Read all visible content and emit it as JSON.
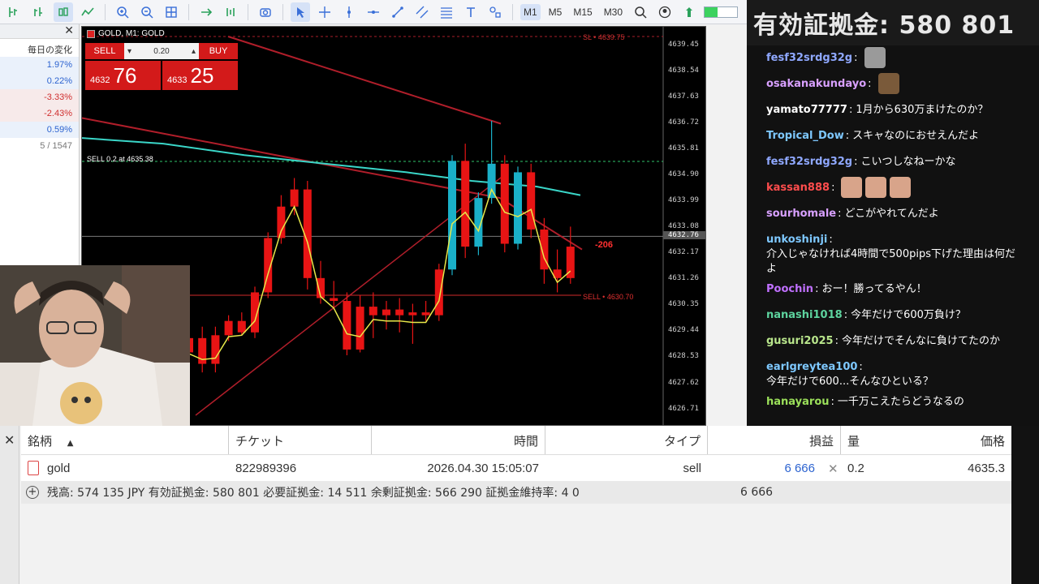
{
  "timeframes": [
    "M1",
    "M5",
    "M15",
    "M30"
  ],
  "market_watch": {
    "column": "毎日の変化",
    "rows": [
      {
        "value": "1.97%",
        "dir": "pos"
      },
      {
        "value": "0.22%",
        "dir": "pos"
      },
      {
        "value": "-3.33%",
        "dir": "neg"
      },
      {
        "value": "-2.43%",
        "dir": "neg"
      },
      {
        "value": "0.59%",
        "dir": "pos"
      }
    ],
    "footer": "5 / 1547"
  },
  "chart": {
    "title": "GOLD, M1:  GOLD",
    "trade_panel": {
      "sell": "SELL",
      "buy": "BUY",
      "lot": "0.20",
      "sell_prefix": "4632",
      "sell_big": "76",
      "buy_prefix": "4633",
      "buy_big": "25"
    },
    "annotations": {
      "order_line": "SELL 0.2 at 4635.38",
      "sl_line": "SL • 4639.75",
      "sell_line": "SELL • 4630.70",
      "profit": "-206",
      "current_price": "4632.76"
    },
    "price_labels": [
      "4639.45",
      "4638.54",
      "4637.63",
      "4636.72",
      "4635.81",
      "4634.90",
      "4633.99",
      "4633.08",
      "4632.17",
      "4631.26",
      "4630.35",
      "4629.44",
      "4628.53",
      "4627.62",
      "4626.71"
    ]
  },
  "chart_data": {
    "type": "candlestick",
    "title": "GOLD, M1:  GOLD",
    "ylim": [
      4626.5,
      4639.75
    ],
    "candles": [
      {
        "o": 4628.7,
        "h": 4629.3,
        "l": 4627.9,
        "c": 4629.2
      },
      {
        "o": 4629.2,
        "h": 4629.6,
        "l": 4628.0,
        "c": 4628.3
      },
      {
        "o": 4628.3,
        "h": 4629.6,
        "l": 4628.0,
        "c": 4629.3
      },
      {
        "o": 4629.3,
        "h": 4630.0,
        "l": 4629.1,
        "c": 4629.8
      },
      {
        "o": 4629.8,
        "h": 4630.1,
        "l": 4629.3,
        "c": 4629.4
      },
      {
        "o": 4629.4,
        "h": 4631.0,
        "l": 4629.2,
        "c": 4630.8
      },
      {
        "o": 4630.8,
        "h": 4632.9,
        "l": 4630.6,
        "c": 4632.7
      },
      {
        "o": 4632.7,
        "h": 4634.2,
        "l": 4632.5,
        "c": 4633.8
      },
      {
        "o": 4633.8,
        "h": 4634.8,
        "l": 4633.5,
        "c": 4634.4
      },
      {
        "o": 4634.4,
        "h": 4634.7,
        "l": 4630.9,
        "c": 4631.3
      },
      {
        "o": 4631.3,
        "h": 4631.9,
        "l": 4630.4,
        "c": 4630.6
      },
      {
        "o": 4630.6,
        "h": 4631.2,
        "l": 4630.2,
        "c": 4630.5
      },
      {
        "o": 4630.5,
        "h": 4630.8,
        "l": 4628.6,
        "c": 4628.8
      },
      {
        "o": 4628.8,
        "h": 4630.7,
        "l": 4628.7,
        "c": 4630.3
      },
      {
        "o": 4630.3,
        "h": 4630.8,
        "l": 4629.2,
        "c": 4630.0
      },
      {
        "o": 4630.0,
        "h": 4630.5,
        "l": 4629.5,
        "c": 4630.2
      },
      {
        "o": 4630.2,
        "h": 4630.6,
        "l": 4629.4,
        "c": 4630.0
      },
      {
        "o": 4630.0,
        "h": 4630.4,
        "l": 4629.0,
        "c": 4630.1
      },
      {
        "o": 4630.1,
        "h": 4630.5,
        "l": 4629.8,
        "c": 4630.0
      },
      {
        "o": 4630.0,
        "h": 4631.8,
        "l": 4629.8,
        "c": 4631.6
      },
      {
        "o": 4631.6,
        "h": 4635.6,
        "l": 4631.4,
        "c": 4635.4
      },
      {
        "o": 4635.4,
        "h": 4636.0,
        "l": 4632.0,
        "c": 4632.4
      },
      {
        "o": 4632.4,
        "h": 4634.3,
        "l": 4632.1,
        "c": 4634.1
      },
      {
        "o": 4634.1,
        "h": 4636.8,
        "l": 4633.9,
        "c": 4635.3
      },
      {
        "o": 4635.3,
        "h": 4635.6,
        "l": 4632.2,
        "c": 4632.5
      },
      {
        "o": 4632.5,
        "h": 4635.2,
        "l": 4632.3,
        "c": 4635.0
      },
      {
        "o": 4635.0,
        "h": 4635.3,
        "l": 4632.7,
        "c": 4633.0
      },
      {
        "o": 4633.0,
        "h": 4633.4,
        "l": 4631.1,
        "c": 4631.6
      },
      {
        "o": 4631.6,
        "h": 4632.3,
        "l": 4630.8,
        "c": 4631.3
      },
      {
        "o": 4631.3,
        "h": 4633.1,
        "l": 4631.1,
        "c": 4632.4
      }
    ],
    "annotations": [
      "SELL 0.2 at 4635.38",
      "SL • 4639.75",
      "SELL • 4630.70",
      "-206"
    ]
  },
  "chat": {
    "banner": "有効証拠金: 580 801",
    "messages": [
      {
        "user": "fesf32srdg32g",
        "color": "#8fa8ff",
        "text": "",
        "emotes": 1,
        "emote_color": "#9a9a9a"
      },
      {
        "user": "osakanakundayo",
        "color": "#d8a0ff",
        "text": "",
        "emotes": 1,
        "emote_color": "#7a5a3a"
      },
      {
        "user": "yamato77777",
        "color": "#ffffff",
        "text": "1月から630万まけたのか？",
        "emotes": 0,
        "emote_color": ""
      },
      {
        "user": "Tropical_Dow",
        "color": "#7ec8ff",
        "text": "スキャなのにおせえんだよ",
        "emotes": 0,
        "emote_color": ""
      },
      {
        "user": "fesf32srdg32g",
        "color": "#8fa8ff",
        "text": "こいつしなねーかな",
        "emotes": 0,
        "emote_color": ""
      },
      {
        "user": "kassan888",
        "color": "#ff4d4d",
        "text": "",
        "emotes": 3,
        "emote_color": "#d8a48a"
      },
      {
        "user": "sourhomale",
        "color": "#d8a0ff",
        "text": "どこがやれてんだよ",
        "emotes": 0,
        "emote_color": ""
      },
      {
        "user": "unkoshinji",
        "color": "#7ec8ff",
        "text": "介入じゃなければ4時間で500pips下げた理由は何だよ",
        "emotes": 0,
        "emote_color": ""
      },
      {
        "user": "Poochin",
        "color": "#c070ff",
        "text": "おー！勝ってるやん！",
        "emotes": 0,
        "emote_color": ""
      },
      {
        "user": "nanashi1018",
        "color": "#5dd39e",
        "text": "今年だけで600万負け？",
        "emotes": 0,
        "emote_color": ""
      },
      {
        "user": "gusuri2025",
        "color": "#b9e68c",
        "text": "今年だけでそんなに負けてたのか",
        "emotes": 0,
        "emote_color": ""
      },
      {
        "user": "earlgreytea100",
        "color": "#7ec8ff",
        "text": "今年だけで600...そんなひといる？",
        "emotes": 0,
        "emote_color": ""
      },
      {
        "user": "hanayarou",
        "color": "#9be05a",
        "text": "一千万こえたらどうなるの",
        "emotes": 0,
        "emote_color": ""
      }
    ]
  },
  "positions": {
    "headers": {
      "symbol": "銘柄",
      "ticket": "チケット",
      "time": "時間",
      "type": "タイプ",
      "profit": "損益",
      "volume": "量",
      "price": "価格"
    },
    "row": {
      "symbol": "gold",
      "ticket": "822989396",
      "time": "2026.04.30 15:05:07",
      "type": "sell",
      "profit": "6 666",
      "volume": "0.2",
      "price": "4635.3"
    },
    "summary": "残高: 574 135 JPY  有効証拠金: 580 801  必要証拠金: 14 511  余剰証拠金: 566 290  証拠金維持率: 4 0",
    "summary_profit": "6 666"
  },
  "colors": {
    "bull": "#1ab0c8",
    "bear": "#e81414",
    "ma_yellow": "#e8e84a",
    "ma_cyan": "#3ad6c8",
    "trend_red": "#b01e2a",
    "profit_blue": "#2c63d0"
  }
}
